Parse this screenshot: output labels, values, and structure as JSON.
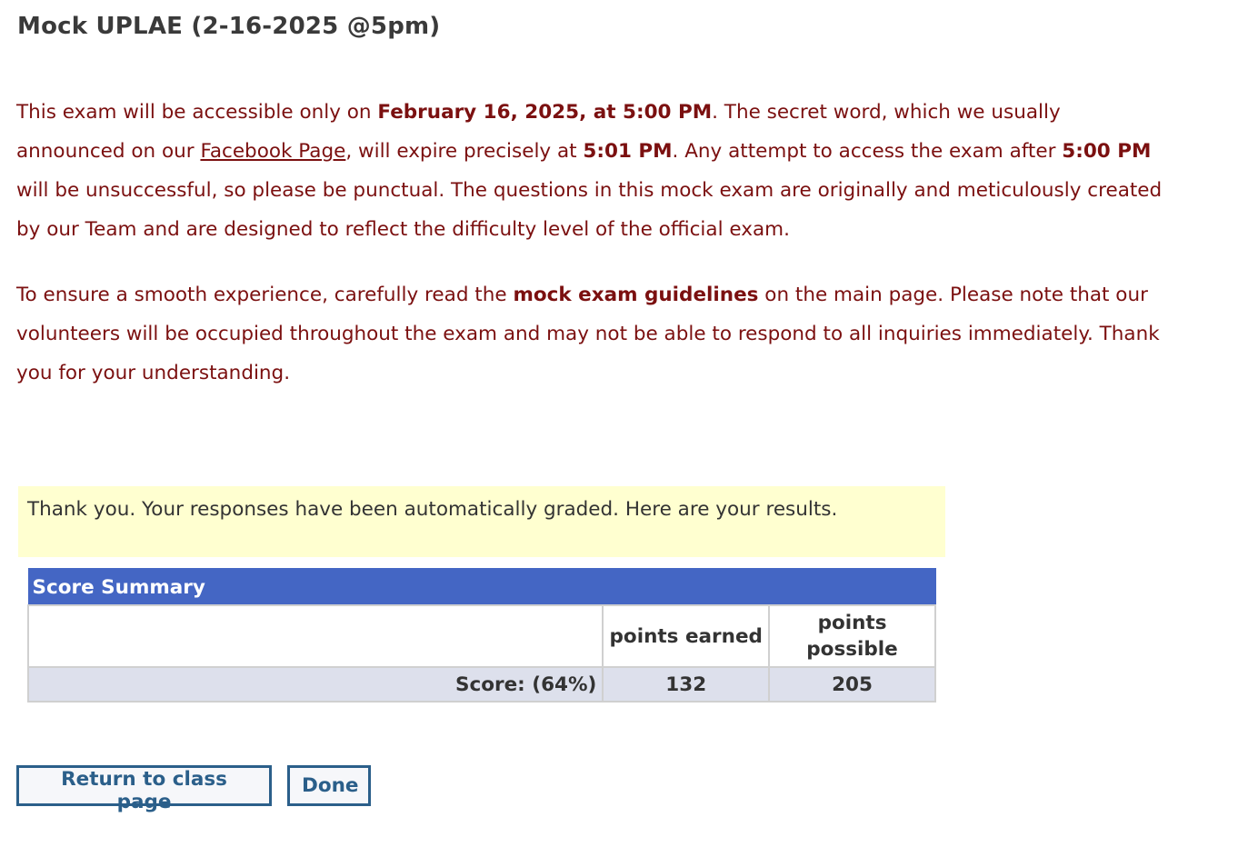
{
  "page": {
    "title": "Mock UPLAE (2-16-2025 @5pm)"
  },
  "intro": {
    "p1": {
      "t1": "This exam will be accessible only on ",
      "b1": "February 16, 2025, at 5:00 PM",
      "t2": ". The secret word, which we usually announced on our ",
      "link": "Facebook Page",
      "t3": ", will expire precisely at ",
      "b2": "5:01 PM",
      "t4": ". Any attempt to access the exam after ",
      "b3": "5:00 PM",
      "t5": " will be unsuccessful, so please be punctual. The questions in this mock exam are originally and meticulously created by our Team and are designed to reflect the difficulty level of the official exam."
    },
    "p2": {
      "t1": "To ensure a smooth experience, carefully read the ",
      "b1": "mock exam guidelines",
      "t2": " on the main page. Please note that our volunteers will be occupied throughout the exam and may not be able to respond to all inquiries immediately. Thank you for your understanding."
    }
  },
  "notice": {
    "text": "Thank you. Your responses have been automatically graded. Here are your results."
  },
  "score_summary": {
    "caption": "Score Summary",
    "col_earned": "points earned",
    "col_possible": "points possible",
    "score_label": "Score: (64%)",
    "earned": "132",
    "possible": "205"
  },
  "buttons": {
    "return_label": "Return to class page",
    "done_label": "Done"
  },
  "colors": {
    "intro_text": "#7b1010",
    "notice_bg": "#ffffd0",
    "table_header_bg": "#4466c4",
    "score_row_bg": "#dde0ec",
    "button_border": "#2b5f8a"
  }
}
